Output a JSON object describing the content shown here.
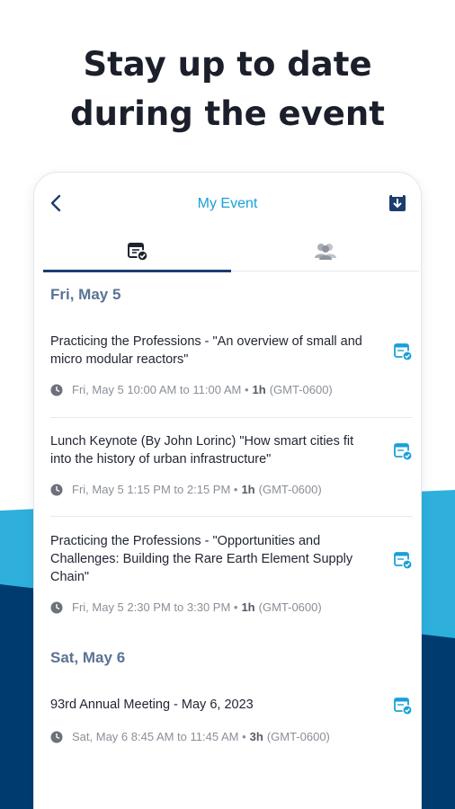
{
  "headline": {
    "line1": "Stay up to date",
    "line2": "during the event"
  },
  "colors": {
    "accent": "#1aa0d8",
    "navy": "#1c3d6e",
    "light_blue": "#2fb0dc",
    "dark_blue": "#003b6f"
  },
  "app": {
    "title": "My Event"
  },
  "icons": {
    "back": "chevron-left-icon",
    "download": "download-icon",
    "tab_schedule": "calendar-check-icon",
    "tab_people": "people-icon",
    "clock": "clock-icon",
    "session_added": "calendar-check-icon"
  },
  "days": [
    {
      "label": "Fri, May 5",
      "sessions": [
        {
          "title": "Practicing the Professions - \"An overview of small and micro modular reactors\"",
          "time": "Fri, May 5 10:00 AM to 11:00 AM •",
          "duration": "1h",
          "tz": "(GMT-0600)"
        },
        {
          "title": "Lunch Keynote (By John Lorinc) \"How smart cities fit into the history of urban infrastructure\"",
          "time": "Fri, May 5 1:15 PM to 2:15 PM •",
          "duration": "1h",
          "tz": "(GMT-0600)"
        },
        {
          "title": "Practicing the Professions - \"Opportunities and Challenges: Building the Rare Earth Element Supply Chain\"",
          "time": "Fri, May 5 2:30 PM to 3:30 PM •",
          "duration": "1h",
          "tz": "(GMT-0600)"
        }
      ]
    },
    {
      "label": "Sat, May 6",
      "sessions": [
        {
          "title": "93rd Annual Meeting - May 6, 2023",
          "time": "Sat, May 6 8:45 AM to 11:45 AM •",
          "duration": "3h",
          "tz": "(GMT-0600)"
        }
      ]
    }
  ]
}
